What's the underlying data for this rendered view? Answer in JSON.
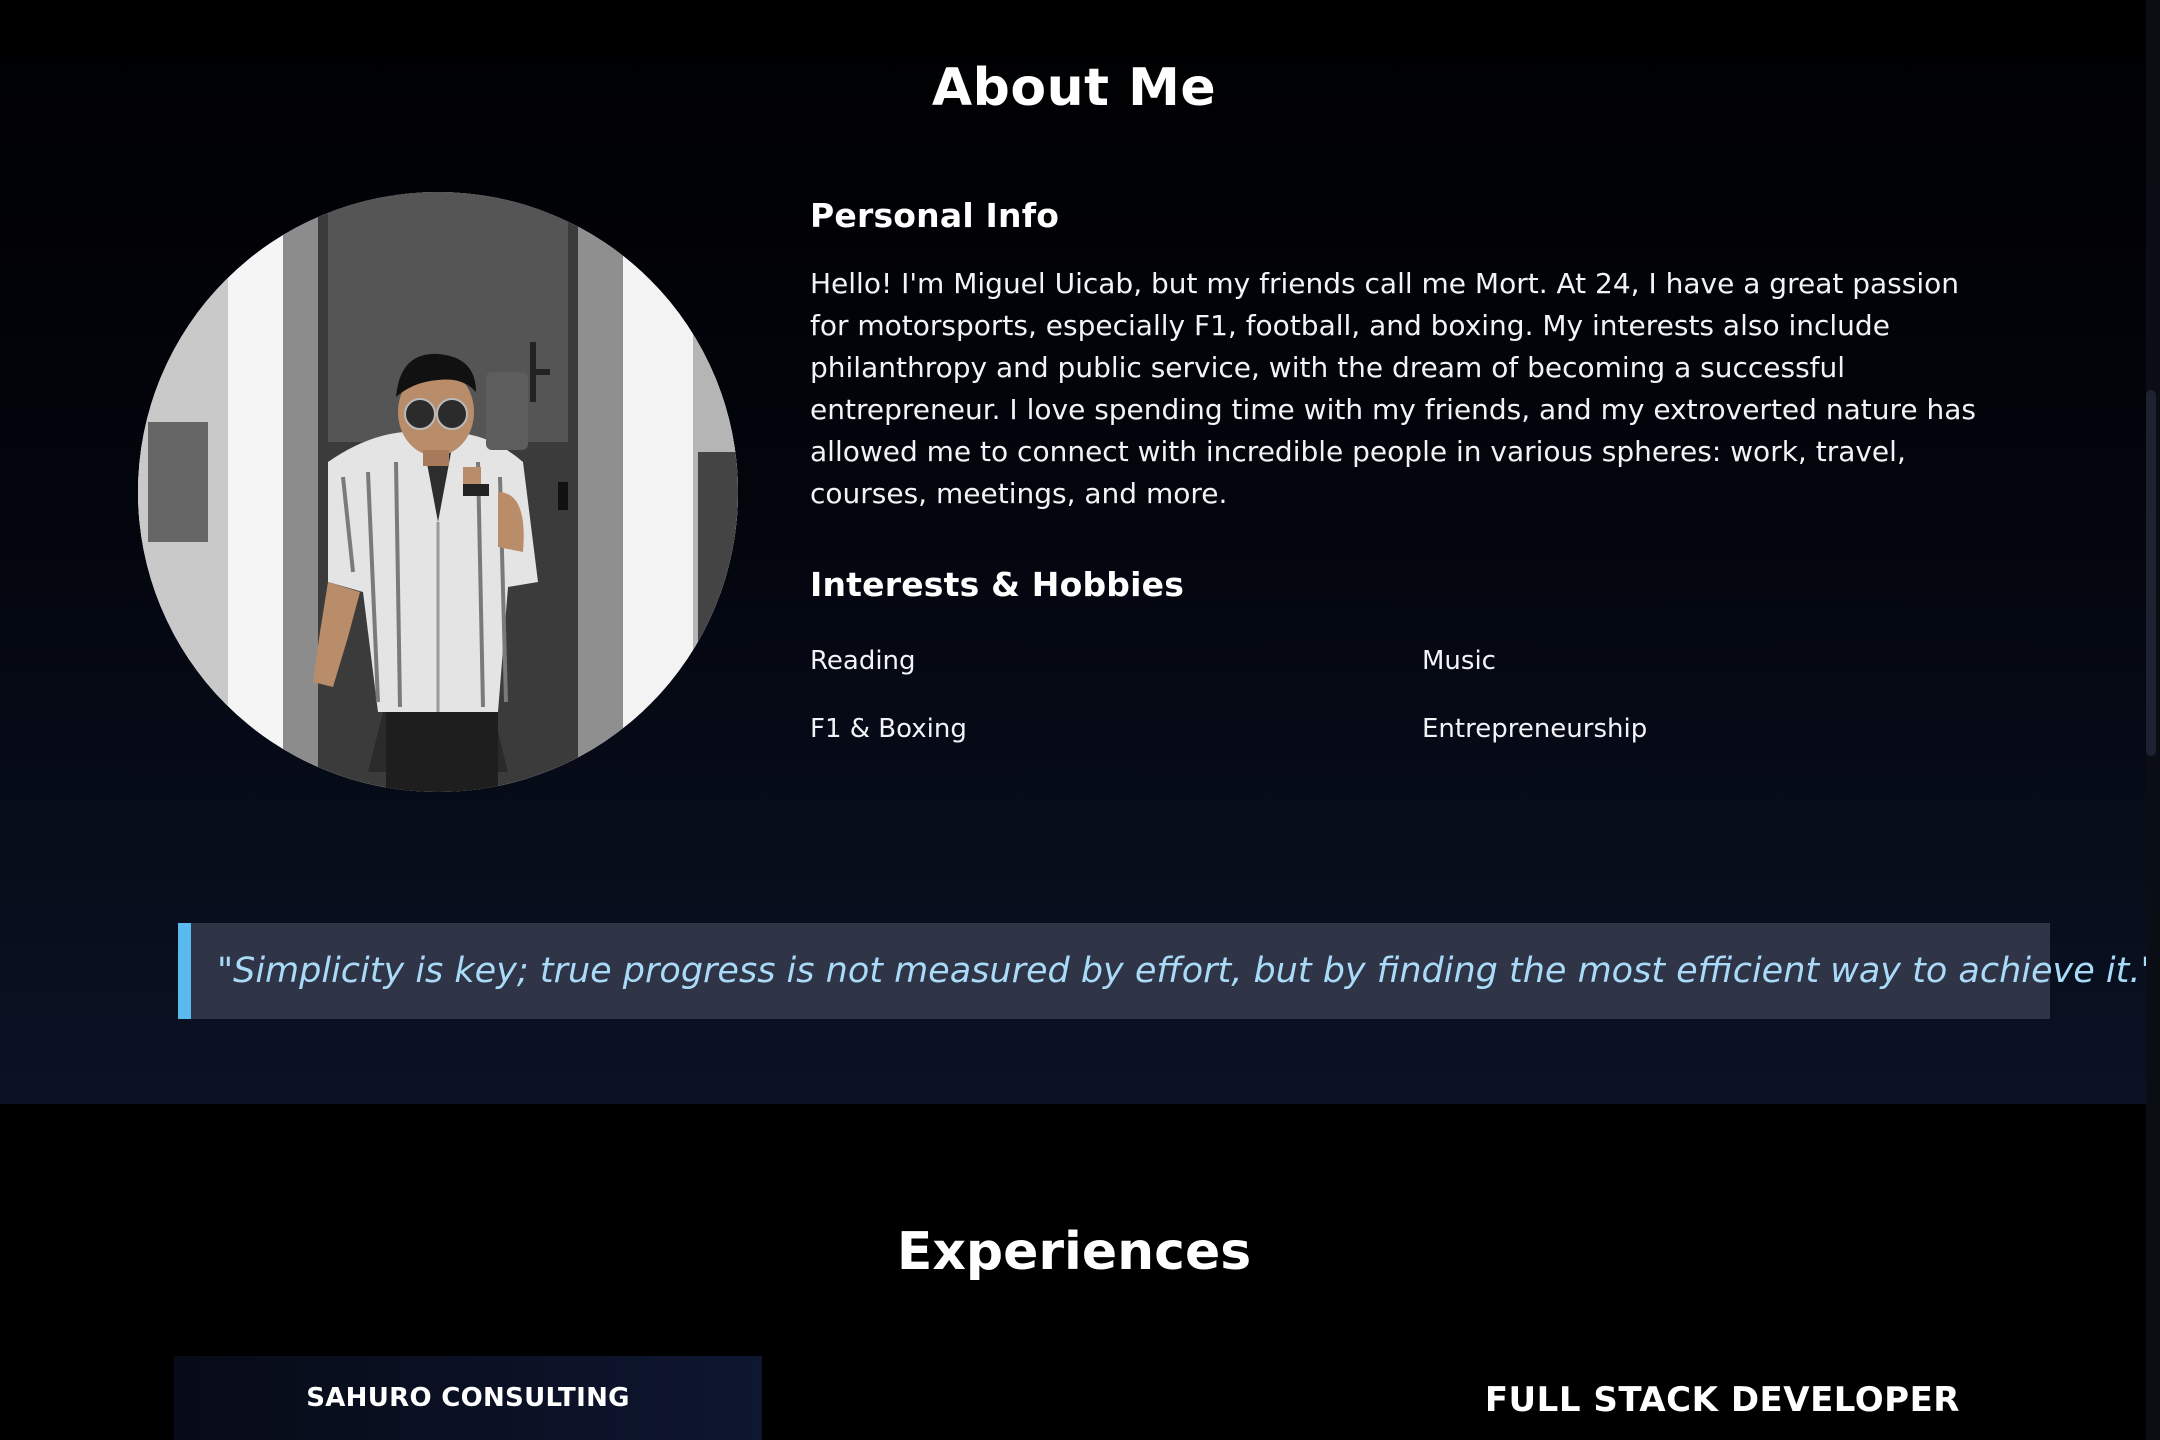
{
  "about": {
    "title": "About Me",
    "personal_info_title": "Personal Info",
    "bio": "Hello! I'm Miguel Uicab, but my friends call me Mort. At 24, I have a great passion for motorsports, especially F1, football, and boxing. My interests also include philanthropy and public service, with the dream of becoming a successful entrepreneur. I love spending time with my friends, and my extroverted nature has allowed me to connect with incredible people in various spheres: work, travel, courses, meetings, and more.",
    "interests_title": "Interests & Hobbies",
    "hobbies": [
      "Reading",
      "Music",
      "F1 & Boxing",
      "Entrepreneurship"
    ],
    "quote": "\"Simplicity is key; true progress is not measured by effort, but by finding the most efficient way to achieve it.\""
  },
  "experiences": {
    "title": "Experiences",
    "company": "SAHURO CONSULTING",
    "role": "FULL STACK DEVELOPER"
  },
  "colors": {
    "quote_accent": "#5ab9ee",
    "quote_text": "#a9dbf9",
    "quote_background": "#2f3447"
  }
}
